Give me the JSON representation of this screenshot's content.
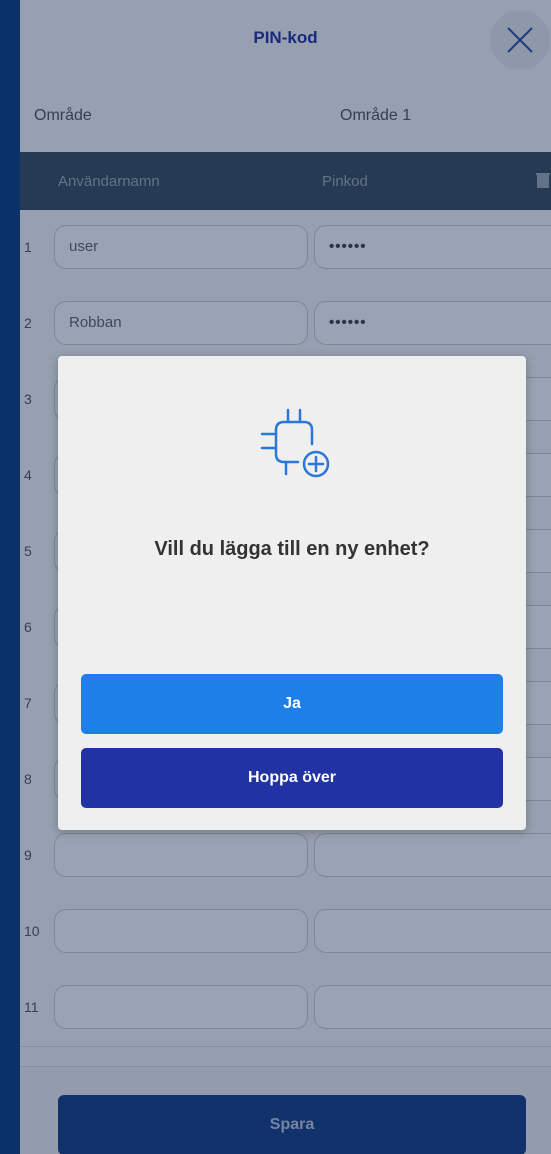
{
  "header": {
    "title": "PIN-kod"
  },
  "area": {
    "label": "Område",
    "value": "Område 1"
  },
  "table": {
    "col_username": "Användarnamn",
    "col_pin": "Pinkod",
    "rows": [
      {
        "num": "1",
        "user": "user",
        "pin": "••••••"
      },
      {
        "num": "2",
        "user": "Robban",
        "pin": "••••••"
      },
      {
        "num": "3",
        "user": "",
        "pin": ""
      },
      {
        "num": "4",
        "user": "",
        "pin": ""
      },
      {
        "num": "5",
        "user": "",
        "pin": ""
      },
      {
        "num": "6",
        "user": "",
        "pin": ""
      },
      {
        "num": "7",
        "user": "",
        "pin": ""
      },
      {
        "num": "8",
        "user": "",
        "pin": ""
      },
      {
        "num": "9",
        "user": "",
        "pin": ""
      },
      {
        "num": "10",
        "user": "",
        "pin": ""
      },
      {
        "num": "11",
        "user": "",
        "pin": ""
      }
    ]
  },
  "footer": {
    "save_label": "Spara"
  },
  "dialog": {
    "icon": "add-device-icon",
    "question": "Vill du lägga till en ny enhet?",
    "yes_label": "Ja",
    "skip_label": "Hoppa över"
  },
  "colors": {
    "frame": "#0f3f7c",
    "title": "#2233a0",
    "yes_button": "#1e7fe8",
    "skip_button": "#2032a4",
    "save_button": "#1b3f82"
  }
}
